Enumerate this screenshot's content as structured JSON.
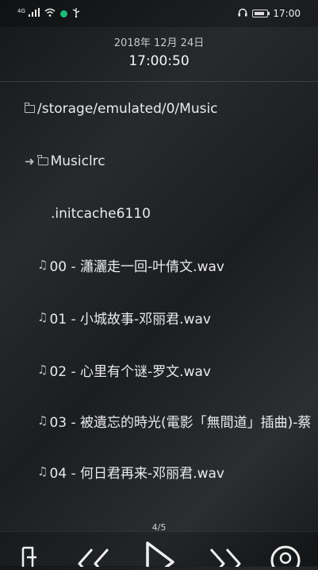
{
  "status_bar": {
    "network": "4G",
    "time": "17:00",
    "icons": [
      "signal-icon",
      "wifi-icon",
      "notification-dot-icon",
      "usb-icon",
      "headphones-icon",
      "battery-icon"
    ],
    "accent_color": "#1fb97a"
  },
  "header": {
    "date": "2018年 12月 24日",
    "time": "17:00:50"
  },
  "file_list": {
    "items": [
      {
        "type": "folder",
        "label": "/storage/emulated/0/Music"
      },
      {
        "type": "folder-current",
        "label": "Musiclrc"
      },
      {
        "type": "file",
        "label": ".initcache6110"
      },
      {
        "type": "music",
        "label": "00 - 瀟灑走一回-叶倩文.wav"
      },
      {
        "type": "music",
        "label": "01 - 小城故事-邓丽君.wav"
      },
      {
        "type": "music",
        "label": "02 - 心里有个谜-罗文.wav"
      },
      {
        "type": "music",
        "label": "03 - 被遺忘的時光(電影「無間道」插曲)-蔡"
      },
      {
        "type": "music",
        "label": "04 - 何日君再来-邓丽君.wav"
      }
    ]
  },
  "pagination": {
    "indicator": "4/5"
  },
  "controls": {
    "icons": [
      "playlist-icon",
      "rewind-icon",
      "play-icon",
      "fast-forward-icon",
      "settings-icon"
    ]
  }
}
